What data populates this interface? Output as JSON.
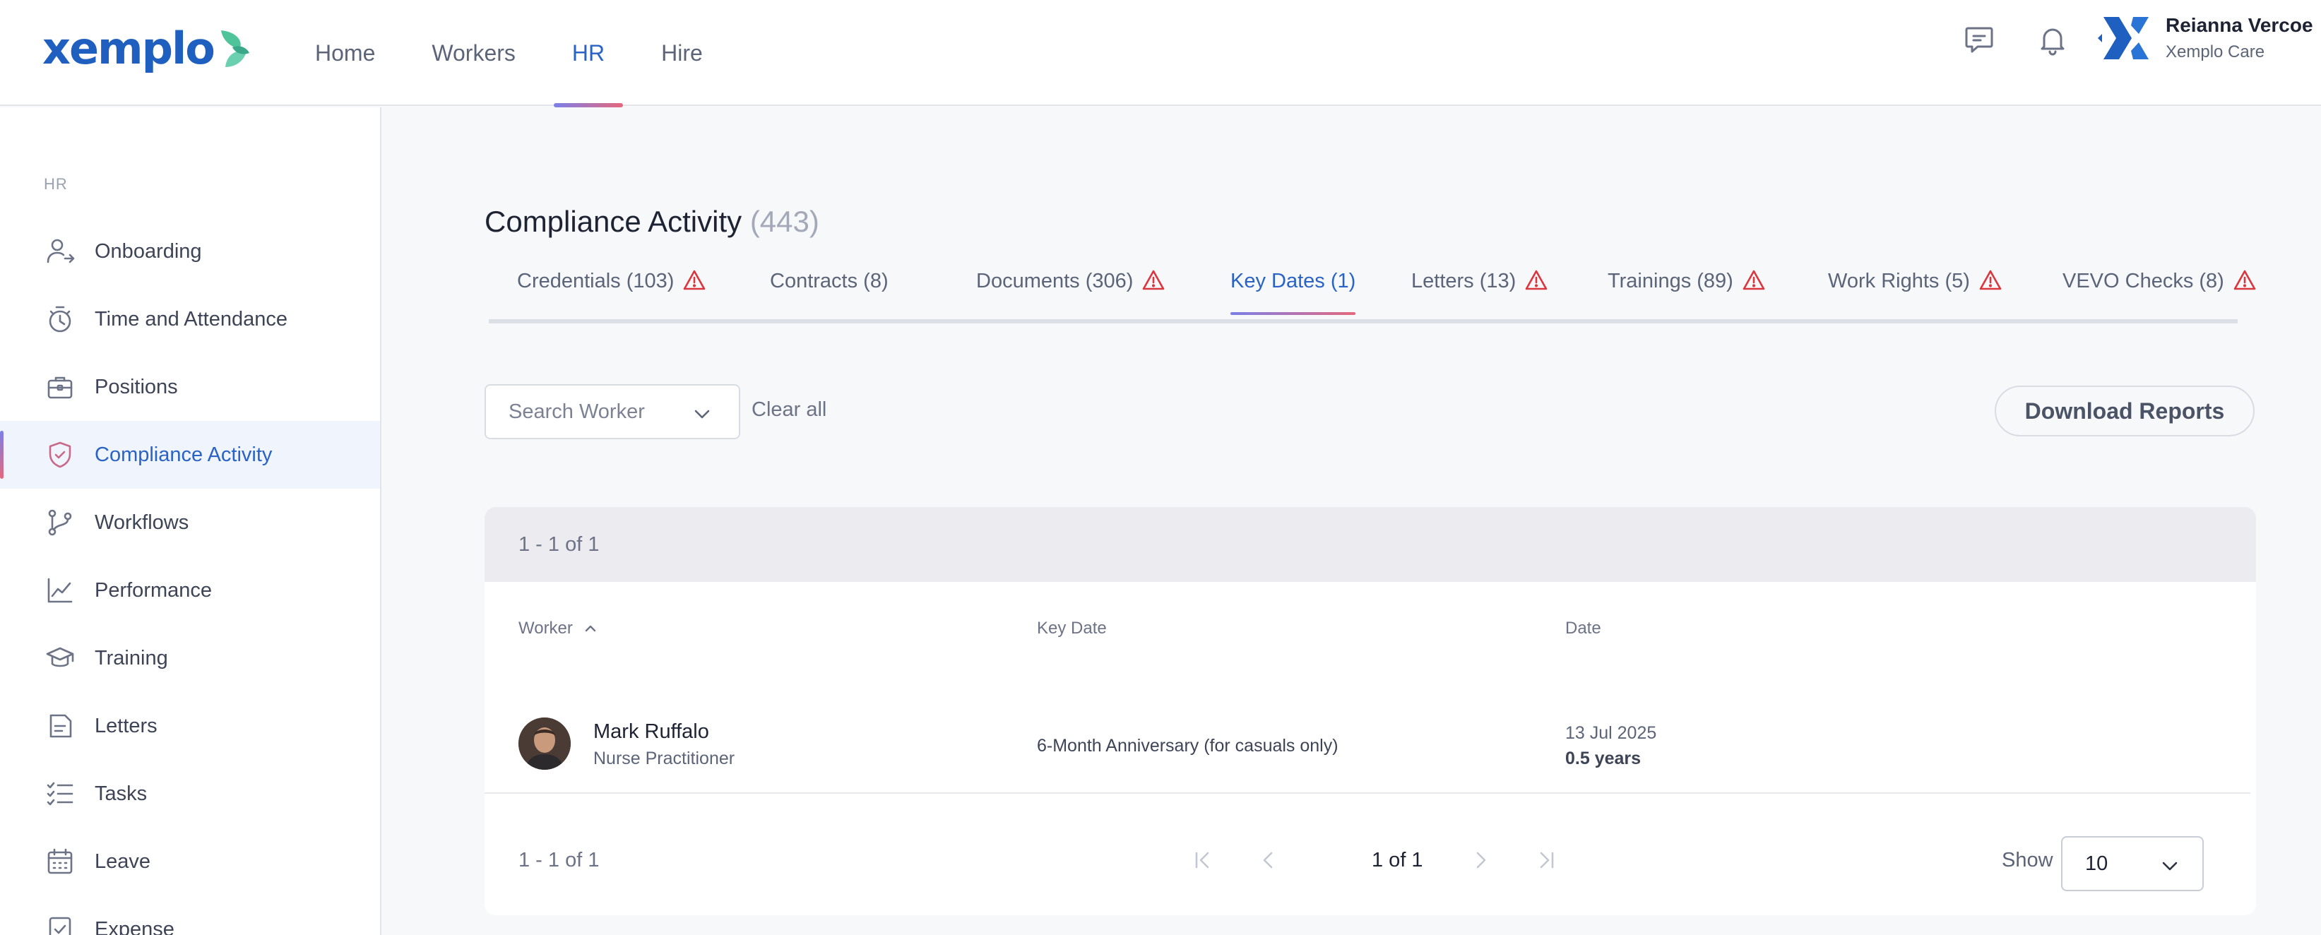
{
  "brand": {
    "logo_text": "xemplo"
  },
  "nav": [
    {
      "label": "Home",
      "active": false
    },
    {
      "label": "Workers",
      "active": false
    },
    {
      "label": "HR",
      "active": true
    },
    {
      "label": "Hire",
      "active": false
    }
  ],
  "user": {
    "name": "Reianna Vercoe",
    "org": "Xemplo Care"
  },
  "sidebar": {
    "section": "HR",
    "items": [
      {
        "label": "Onboarding",
        "icon": "user-arrow-icon"
      },
      {
        "label": "Time and Attendance",
        "icon": "stopwatch-icon"
      },
      {
        "label": "Positions",
        "icon": "briefcase-icon"
      },
      {
        "label": "Compliance Activity",
        "icon": "shield-check-icon",
        "active": true
      },
      {
        "label": "Workflows",
        "icon": "git-branch-icon"
      },
      {
        "label": "Performance",
        "icon": "line-chart-icon"
      },
      {
        "label": "Training",
        "icon": "graduation-cap-icon"
      },
      {
        "label": "Letters",
        "icon": "document-icon"
      },
      {
        "label": "Tasks",
        "icon": "checklist-icon"
      },
      {
        "label": "Leave",
        "icon": "calendar-icon"
      },
      {
        "label": "Expense",
        "icon": "receipt-icon"
      }
    ]
  },
  "page": {
    "title": "Compliance Activity",
    "count": "(443)"
  },
  "tabs": [
    {
      "label": "Credentials (103)",
      "warning": true
    },
    {
      "label": "Contracts (8)",
      "warning": false
    },
    {
      "label": "Documents (306)",
      "warning": true
    },
    {
      "label": "Key Dates (1)",
      "warning": false,
      "active": true
    },
    {
      "label": "Letters (13)",
      "warning": true
    },
    {
      "label": "Trainings (89)",
      "warning": true
    },
    {
      "label": "Work Rights (5)",
      "warning": true
    },
    {
      "label": "VEVO Checks (8)",
      "warning": true
    }
  ],
  "filters": {
    "search_placeholder": "Search Worker",
    "clear_all": "Clear all",
    "download": "Download Reports"
  },
  "table": {
    "range_top": "1 - 1 of 1",
    "columns": {
      "worker": "Worker",
      "key_date": "Key Date",
      "date": "Date"
    },
    "rows": [
      {
        "name": "Mark Ruffalo",
        "role": "Nurse Practitioner",
        "key_date": "6-Month Anniversary (for casuals only)",
        "date": "13 Jul 2025",
        "tenure": "0.5 years"
      }
    ],
    "range_bottom": "1 - 1 of 1",
    "page_text": "1 of 1",
    "show_label": "Show",
    "page_size": "10"
  },
  "colors": {
    "accent": "#2a63c6",
    "warning": "#d9363e",
    "gradient_start": "#7b7fe8",
    "gradient_end": "#e5687d"
  }
}
